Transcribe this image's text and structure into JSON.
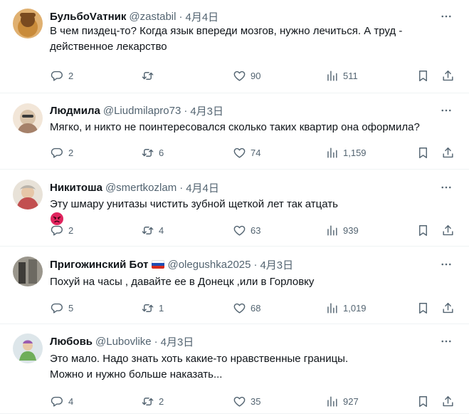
{
  "tweets": [
    {
      "name": "БульбоVатник",
      "handle": "@zastabil",
      "date": "4月4日",
      "flag": false,
      "lines": [
        "В чем пиздец-то? Когда язык впереди мозгов, нужно лечиться. А труд -",
        "действенное лекарство"
      ],
      "replies": "2",
      "retweets": "",
      "likes": "90",
      "views": "511",
      "avatar_colors": [
        "#c98b3a",
        "#7a4a1f",
        "#e0b070"
      ]
    },
    {
      "name": "Людмила",
      "handle": "@Liudmilapro73",
      "date": "4月3日",
      "flag": false,
      "lines": [
        "Мягко, и никто не поинтересовался сколько таких квартир она оформила?"
      ],
      "replies": "2",
      "retweets": "6",
      "likes": "74",
      "views": "1,159",
      "avatar_colors": [
        "#d8c2a8",
        "#a5816a",
        "#f2e6d8"
      ]
    },
    {
      "name": "Никитоша",
      "handle": "@smertkozlam",
      "date": "4月4日",
      "flag": false,
      "lines": [
        "Эту шмару унитазы чистить зубной щеткой лет так атцать"
      ],
      "emoji": "angry-face",
      "replies": "2",
      "retweets": "4",
      "likes": "63",
      "views": "939",
      "avatar_colors": [
        "#b9b3aa",
        "#c25050",
        "#e8e2d8"
      ]
    },
    {
      "name": "Пригожинский Бот",
      "handle": "@olegushka2025",
      "date": "4月3日",
      "flag": true,
      "lines": [
        "Похуй на часы , давайте ее в Донецк ,или в Горловку"
      ],
      "replies": "5",
      "retweets": "1",
      "likes": "68",
      "views": "1,019",
      "avatar_colors": [
        "#6d6a62",
        "#3e3c38",
        "#9a968c"
      ]
    },
    {
      "name": "Любовь",
      "handle": "@Lubovlike",
      "date": "4月3日",
      "flag": false,
      "lines": [
        "Это мало. Надо знать хоть какие-то нравственные границы.",
        "Можно и нужно больше наказать..."
      ],
      "replies": "4",
      "retweets": "2",
      "likes": "35",
      "views": "927",
      "avatar_colors": [
        "#dde6ea",
        "#6fae5a",
        "#9a5bb0"
      ]
    }
  ],
  "colors": {
    "text": "#0f1419",
    "secondary": "#536471",
    "divider": "#eff3f4"
  },
  "icons": [
    "reply-icon",
    "retweet-icon",
    "like-icon",
    "views-icon",
    "bookmark-icon",
    "share-icon",
    "more-icon"
  ]
}
